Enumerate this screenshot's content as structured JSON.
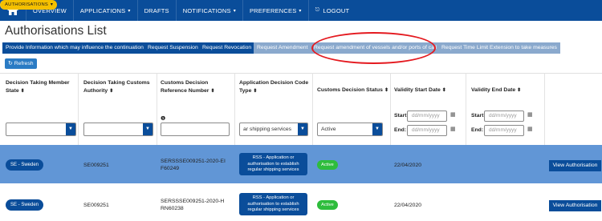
{
  "nav": {
    "items": [
      {
        "label": "OVERVIEW",
        "caret": false
      },
      {
        "label": "APPLICATIONS",
        "caret": true
      },
      {
        "label": "AUTHORISATIONS",
        "caret": true
      },
      {
        "label": "DRAFTS",
        "caret": false
      },
      {
        "label": "NOTIFICATIONS",
        "caret": true
      },
      {
        "label": "PREFERENCES",
        "caret": true
      },
      {
        "label": "LOGOUT",
        "caret": false
      }
    ],
    "active": "AUTHORISATIONS"
  },
  "page_title": "Authorisations List",
  "actions": [
    {
      "label": "Provide Information which may influence the continuation",
      "enabled": true
    },
    {
      "label": "Request Suspension",
      "enabled": true
    },
    {
      "label": "Request Revocation",
      "enabled": true
    },
    {
      "label": "Request Amendment",
      "enabled": false
    },
    {
      "label": "Request amendment of vessels and/or ports of call",
      "enabled": false
    },
    {
      "label": "Request Time Limit Extension to take measures",
      "enabled": false
    }
  ],
  "refresh_label": "Refresh",
  "columns": [
    "Decision Taking Member State",
    "Decision Taking Customs Authority",
    "Customs Decision Reference Number",
    "Application Decision Code Type",
    "Customs Decision Status",
    "Validity Start Date",
    "Validity End Date"
  ],
  "filters": {
    "decision_code_type": "ar shipping services",
    "status": "Active",
    "start_label": "Start:",
    "end_label": "End:",
    "date_placeholder": "dd/mm/yyyy"
  },
  "rows": [
    {
      "member_state": "SE - Sweden",
      "authority": "SE009251",
      "reference": "SERSSSE009251-2020-EIF60249",
      "type": "RSS - Application or authorisation to establish regular shipping services",
      "status": "Active",
      "start": "22/04/2020",
      "end": "",
      "view": "View Authorisation",
      "selected": true
    },
    {
      "member_state": "SE - Sweden",
      "authority": "SE009251",
      "reference": "SERSSSE009251-2020-HRN60238",
      "type": "RSS - Application or authorisation to establish regular shipping services",
      "status": "Active",
      "start": "22/04/2020",
      "end": "",
      "view": "View Authorisation",
      "selected": false
    }
  ],
  "colors": {
    "nav": "#0a4d9a",
    "active_tab": "#f5c000",
    "selected_row": "#6196d6",
    "status_active": "#2ebd3c",
    "highlight": "#e4191f"
  }
}
